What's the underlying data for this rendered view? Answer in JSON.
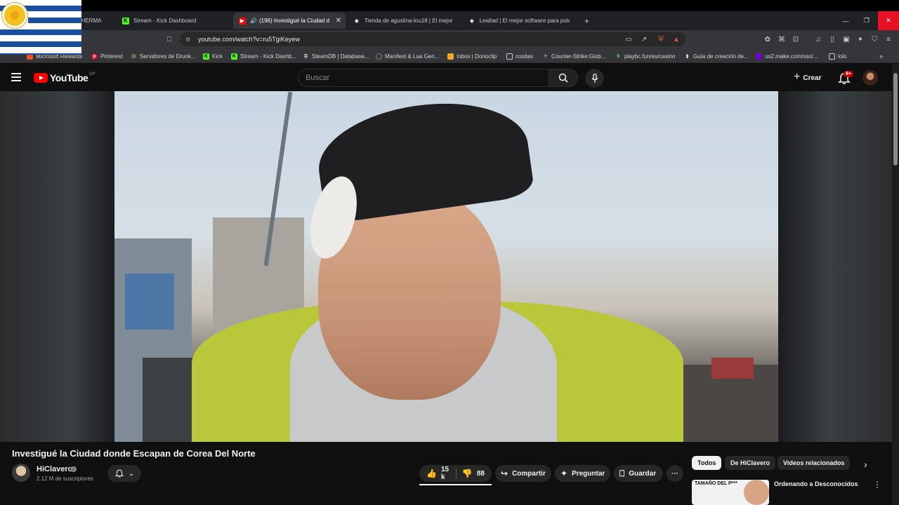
{
  "browser": {
    "tabs": [
      {
        "title": "LA HERMA",
        "icon": "tab-icon"
      },
      {
        "title": "Stream - Kick Dashboard",
        "icon": "kick-icon"
      },
      {
        "title": "(196) Investigué la Ciudad de",
        "icon": "youtube-icon",
        "active": true
      },
      {
        "title": "Tienda de agustina-lou18 | El mejor s",
        "icon": "store-icon"
      },
      {
        "title": "Lealtad | El mejor software para pote",
        "icon": "store-icon"
      }
    ],
    "new_tab": "+",
    "url": "youtube.com/watch?v=ru5TgiKeyew",
    "bookmarks": [
      "Microsoft Rewards",
      "Pinterest",
      "Servidores de Drunk...",
      "Kick",
      "Stream - Kick Dashb...",
      "SteamDB | Database...",
      "Manifest & Lua Gen...",
      "Inbox | Donoclip",
      "cositas",
      "Counter-Strike:Glob...",
      "playbc.fun/es/casino",
      "Guía de creación de...",
      "us2.make.com/sso/...",
      "lolo"
    ]
  },
  "youtube": {
    "logo": "YouTube",
    "country": "UY",
    "search_placeholder": "Buscar",
    "create_label": "Crear",
    "notif_badge": "9+"
  },
  "video": {
    "title": "Investigué la Ciudad donde Escapan de Corea Del Norte",
    "channel": "HiClavero",
    "subscribers": "2.12 M de suscriptores",
    "likes": "15 k",
    "dislikes": "88",
    "share": "Compartir",
    "ask": "Preguntar",
    "save": "Guardar",
    "more": "···"
  },
  "sidebar": {
    "chips": [
      "Todos",
      "De HiClavero",
      "Videos relacionados"
    ],
    "recommended": {
      "thumb_text": "TAMAÑO DEL P***",
      "title": "Ordenando a Desconocidos"
    }
  },
  "colors": {
    "accent": "#ff0000",
    "background": "#0f0f0f",
    "chrome": "#35363a"
  }
}
